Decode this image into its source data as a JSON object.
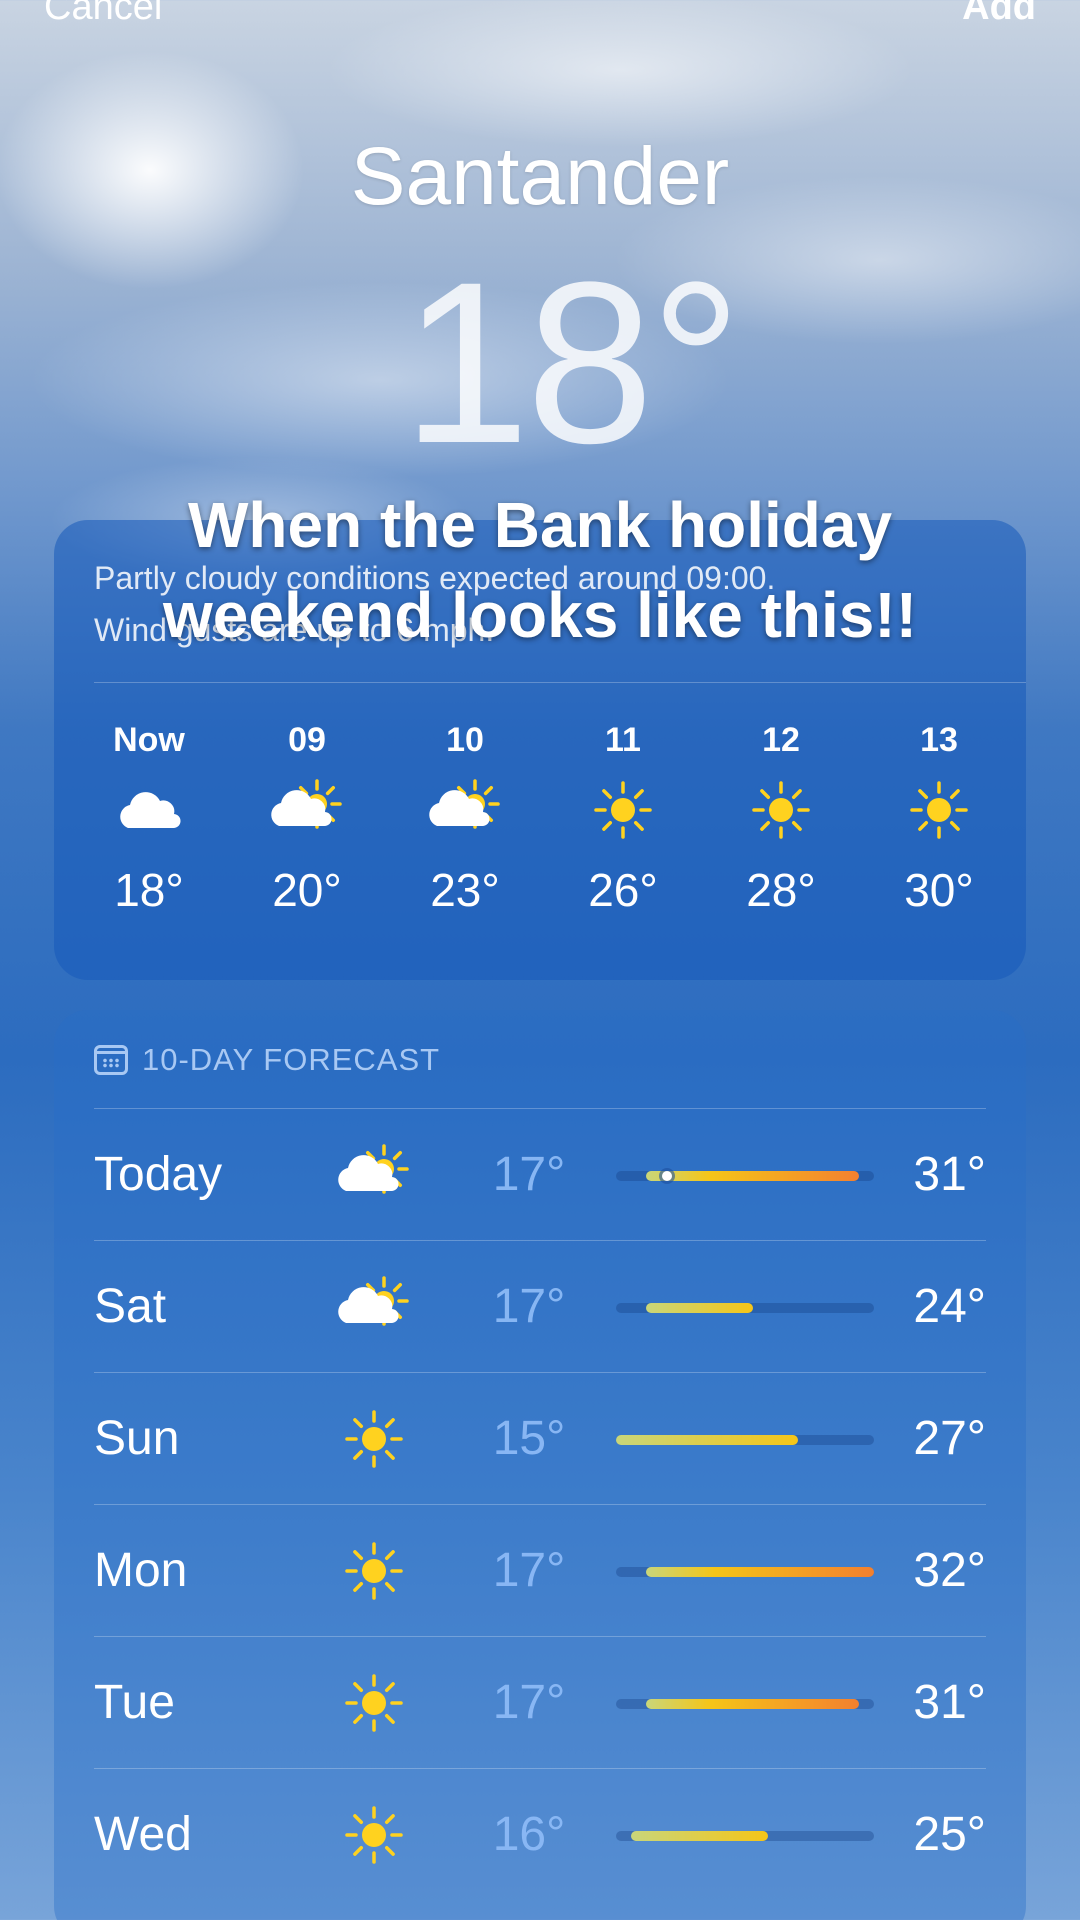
{
  "topbar": {
    "cancel_label": "Cancel",
    "add_label": "Add"
  },
  "location": {
    "city": "Santander",
    "current_temp": "18°"
  },
  "caption": {
    "line1": "When the Bank holiday",
    "line2": "weekend looks like this!!"
  },
  "hourly": {
    "summary_line1": "Partly cloudy conditions expected around 09:00.",
    "summary_line2": "Wind gusts are up to 6 mph.",
    "items": [
      {
        "label": "Now",
        "icon": "cloud-icon",
        "temp": "18°"
      },
      {
        "label": "09",
        "icon": "partly-sunny-icon",
        "temp": "20°"
      },
      {
        "label": "10",
        "icon": "partly-sunny-icon",
        "temp": "23°"
      },
      {
        "label": "11",
        "icon": "sun-icon",
        "temp": "26°"
      },
      {
        "label": "12",
        "icon": "sun-icon",
        "temp": "28°"
      },
      {
        "label": "13",
        "icon": "sun-icon",
        "temp": "30°"
      }
    ]
  },
  "forecast": {
    "header": "10-DAY FORECAST",
    "range_low": 15,
    "range_high": 32,
    "days": [
      {
        "day": "Today",
        "icon": "partly-sunny-icon",
        "low": "17°",
        "high": "31°",
        "low_val": 17,
        "high_val": 31,
        "current_val": 18
      },
      {
        "day": "Sat",
        "icon": "partly-sunny-icon",
        "low": "17°",
        "high": "24°",
        "low_val": 17,
        "high_val": 24
      },
      {
        "day": "Sun",
        "icon": "sun-icon",
        "low": "15°",
        "high": "27°",
        "low_val": 15,
        "high_val": 27
      },
      {
        "day": "Mon",
        "icon": "sun-icon",
        "low": "17°",
        "high": "32°",
        "low_val": 17,
        "high_val": 32
      },
      {
        "day": "Tue",
        "icon": "sun-icon",
        "low": "17°",
        "high": "31°",
        "low_val": 17,
        "high_val": 31
      },
      {
        "day": "Wed",
        "icon": "sun-icon",
        "low": "16°",
        "high": "25°",
        "low_val": 16,
        "high_val": 25
      }
    ]
  },
  "colors": {
    "sun": "#ffd21f",
    "cool": "#c9d67a",
    "warm": "#f5c518",
    "hot": "#f3802f"
  }
}
